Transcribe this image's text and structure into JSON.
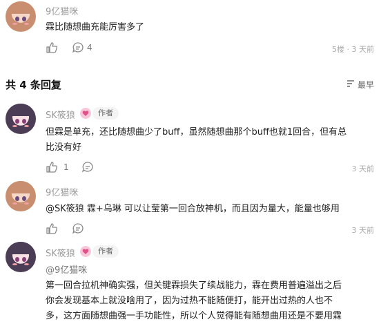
{
  "top_reply": {
    "username": "9亿猫咪",
    "text": "霖比随想曲充能厉害多了",
    "like_count": "",
    "comment_count": "4",
    "meta": "5楼 · 3 天前"
  },
  "replies_header": {
    "title": "共 4 条回复",
    "sort_label": "最早"
  },
  "replies": [
    {
      "username": "SK筱狼",
      "author_tag": "作者",
      "text_line1": "但霖是单充，还比随想曲少了buff，虽然随想曲那个buff也就1回合，但有总",
      "text_line2": "比没有好",
      "like_count": "1",
      "time": "3 天前"
    },
    {
      "username": "9亿猫咪",
      "text": "@SK筱狼 霖+乌琳 可以让莹第一回合放神机，而且因为量大，能量也够用",
      "time": "3 天前"
    },
    {
      "username": "SK筱狼",
      "author_tag": "作者",
      "mention": "@9亿猫咪",
      "text_line1": "第一回合拉机神确实强，但关键霖损失了续战能力，霖在费用普遍溢出之后",
      "text_line2": "你会发现基本上就没啥用了，因为过热不能随便打，能开出过热的人也不",
      "text_line3": "多，这方面随想曲强一手功能性，所以个人觉得能有随想曲用还是不要用霖"
    }
  ],
  "colors": {
    "text": "#222222",
    "muted": "#999999",
    "badge_pink": "#f7c6d8"
  }
}
